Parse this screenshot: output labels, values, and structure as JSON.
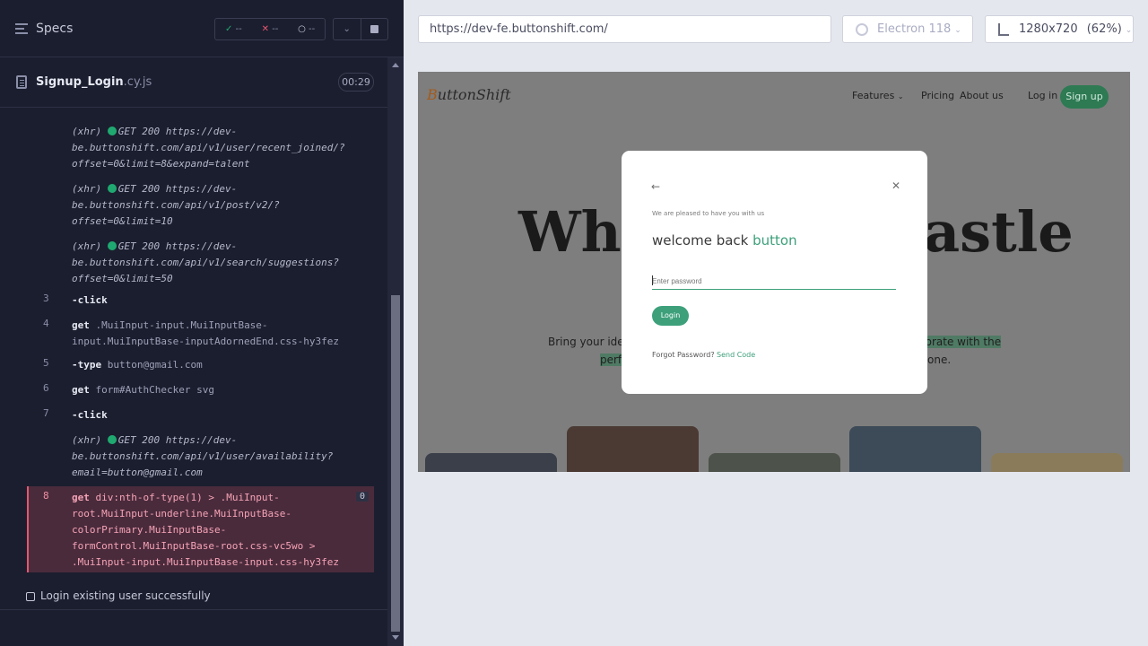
{
  "runner": {
    "specs_title": "Specs",
    "stats": {
      "passed": "--",
      "failed": "--",
      "pending": "--"
    },
    "file": {
      "name": "Signup_Login",
      "ext": ".cy.js",
      "timer": "00:29"
    },
    "log": [
      {
        "type": "xhr",
        "prefix": "(xhr)",
        "method": "GET 200",
        "url_lines": [
          "https://dev-",
          "be.buttonshift.com/api/v1/user/recent_joined/?",
          "offset=0&limit=8&expand=talent"
        ]
      },
      {
        "type": "xhr",
        "prefix": "(xhr)",
        "method": "GET 200",
        "url_lines": [
          "https://dev-",
          "be.buttonshift.com/api/v1/post/v2/?",
          "offset=0&limit=10"
        ]
      },
      {
        "type": "xhr",
        "prefix": "(xhr)",
        "method": "GET 200",
        "url_lines": [
          "https://dev-",
          "be.buttonshift.com/api/v1/search/suggestions?",
          "offset=0&limit=50"
        ]
      },
      {
        "type": "cmd",
        "num": "3",
        "cmd": "-click",
        "arg": ""
      },
      {
        "type": "cmd",
        "num": "4",
        "cmd": "get",
        "arg_lines": [
          ".MuiInput-input.MuiInputBase-",
          "input.MuiInputBase-inputAdornedEnd.css-hy3fez"
        ]
      },
      {
        "type": "cmd",
        "num": "5",
        "cmd": "-type",
        "arg": "button@gmail.com"
      },
      {
        "type": "cmd",
        "num": "6",
        "cmd": "get",
        "arg": "form#AuthChecker svg"
      },
      {
        "type": "cmd",
        "num": "7",
        "cmd": "-click",
        "arg": ""
      },
      {
        "type": "xhr",
        "prefix": "(xhr)",
        "method": "GET 200",
        "url_lines": [
          "https://dev-",
          "be.buttonshift.com/api/v1/user/availability?",
          "email=button@gmail.com"
        ]
      },
      {
        "type": "err",
        "num": "8",
        "cmd": "get",
        "badge": "0",
        "arg_lines": [
          "div:nth-of-type(1) > .MuiInput-",
          "root.MuiInput-underline.MuiInputBase-",
          "colorPrimary.MuiInputBase-",
          "formControl.MuiInputBase-root.css-vc5wo >",
          ".MuiInput-input.MuiInputBase-input.css-hy3fez"
        ]
      }
    ],
    "test_title": "Login existing user successfully"
  },
  "browser_bar": {
    "url": "https://dev-fe.buttonshift.com/",
    "browser": "Electron 118",
    "viewport": "1280x720",
    "scale": "(62%)"
  },
  "site": {
    "logo_prefix": "B",
    "logo_rest": "uttonShift",
    "nav": [
      "Features",
      "Pricing",
      "About us",
      "Log in"
    ],
    "signup": "Sign up",
    "hero_left": "Whe",
    "hero_right": "astle",
    "sub_left": "Bring your ide",
    "sub_left2": "perf",
    "sub_right": "borate with the",
    "sub_right2": "one."
  },
  "modal": {
    "pleased": "We are pleased to have you with us",
    "welcome": "welcome back",
    "user": "button",
    "password_placeholder": "Enter password",
    "login": "Login",
    "forgot": "Forgot Password?",
    "send_code": "Send Code"
  },
  "colors": {
    "accent": "#3da07b",
    "error": "#e45770",
    "pass": "#1fa971"
  }
}
